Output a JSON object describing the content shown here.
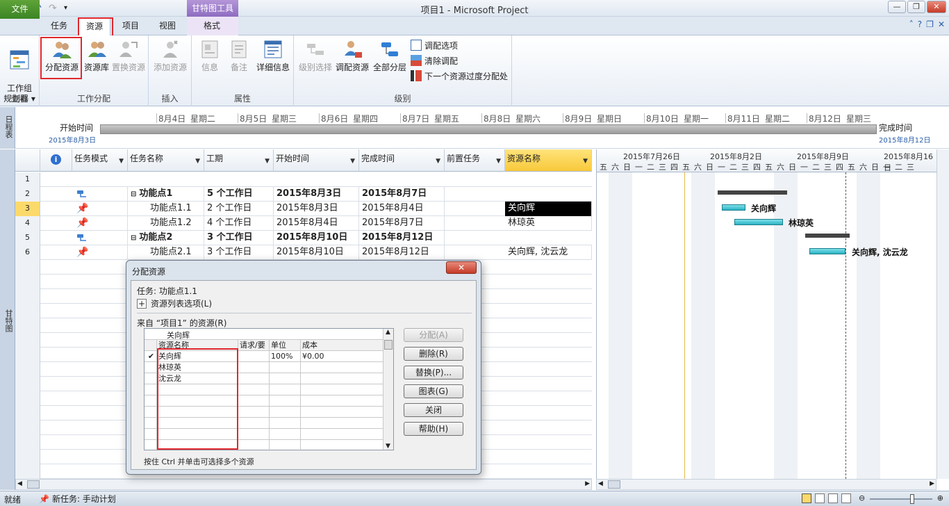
{
  "window": {
    "title": "项目1 - Microsoft Project",
    "context_group": "甘特图工具"
  },
  "tabs": [
    "文件",
    "任务",
    "资源",
    "项目",
    "视图",
    "格式"
  ],
  "ribbon": {
    "groups": {
      "view": {
        "label": "查看",
        "team_planner": "工作组\n规划器 ▾"
      },
      "assignments": {
        "label": "工作分配",
        "assign": "分配资源",
        "pool": "资源库",
        "replace": "置换资源"
      },
      "insert": {
        "label": "插入",
        "add": "添加资源"
      },
      "properties": {
        "label": "属性",
        "info": "信息",
        "notes": "备注",
        "details": "详细信息"
      },
      "level": {
        "label": "级别",
        "level_selection": "级别选择",
        "level_resource": "调配资源",
        "level_all": "全部分层",
        "options": "调配选项",
        "clear": "清除调配",
        "next": "下一个资源过度分配处"
      }
    }
  },
  "timeline": {
    "side_label": "日程表",
    "start_label": "开始时间",
    "start_date": "2015年8月3日",
    "end_label": "完成时间",
    "end_date": "2015年8月12日",
    "dates": [
      "8月4日",
      "星期二",
      "8月5日",
      "星期三",
      "8月6日",
      "星期四",
      "8月7日",
      "星期五",
      "8月8日",
      "星期六",
      "8月9日",
      "星期日",
      "8月10日",
      "星期一",
      "8月11日",
      "星期二",
      "8月12日",
      "星期三"
    ]
  },
  "gantt_side_label": "甘特图",
  "table": {
    "headers": [
      "任务模式",
      "任务名称",
      "工期",
      "开始时间",
      "完成时间",
      "前置任务",
      "资源名称"
    ],
    "rows": [
      {
        "id": "1",
        "name": "",
        "duration": "",
        "start": "",
        "finish": "",
        "resource": ""
      },
      {
        "id": "2",
        "name": "功能点1",
        "duration": "5 个工作日",
        "start": "2015年8月3日",
        "finish": "2015年8月7日",
        "resource": ""
      },
      {
        "id": "3",
        "name": "功能点1.1",
        "duration": "2 个工作日",
        "start": "2015年8月3日",
        "finish": "2015年8月4日",
        "resource": "关向辉"
      },
      {
        "id": "4",
        "name": "功能点1.2",
        "duration": "4 个工作日",
        "start": "2015年8月4日",
        "finish": "2015年8月7日",
        "resource": "林琼英"
      },
      {
        "id": "5",
        "name": "功能点2",
        "duration": "3 个工作日",
        "start": "2015年8月10日",
        "finish": "2015年8月12日",
        "resource": ""
      },
      {
        "id": "6",
        "name": "功能点2.1",
        "duration": "3 个工作日",
        "start": "2015年8月10日",
        "finish": "2015年8月12日",
        "resource": "关向辉, 沈云龙"
      }
    ]
  },
  "gantt": {
    "weeks": [
      "2015年7月26日",
      "2015年8月2日",
      "2015年8月9日",
      "2015年8月16日"
    ],
    "days": [
      "五",
      "六",
      "日",
      "一",
      "二",
      "三",
      "四",
      "五",
      "六",
      "日",
      "一",
      "二",
      "三",
      "四",
      "五",
      "六",
      "日",
      "一",
      "二",
      "三",
      "四",
      "五",
      "六",
      "日",
      "一",
      "二",
      "三"
    ],
    "labels": [
      "关向辉",
      "林琼英",
      "关向辉, 沈云龙"
    ]
  },
  "dialog": {
    "title": "分配资源",
    "close": "✕",
    "task_label": "任务: 功能点1.1",
    "options_label": "资源列表选项(L)",
    "from_label": "来自 “项目1” 的资源(R)",
    "edit_value": "关向辉",
    "grid_headers": [
      "资源名称",
      "请求/要",
      "单位",
      "成本"
    ],
    "grid_rows": [
      {
        "check": "✔",
        "name": "关向辉",
        "units": "100%",
        "cost": "¥0.00"
      },
      {
        "check": "",
        "name": "林琼英",
        "units": "",
        "cost": ""
      },
      {
        "check": "",
        "name": "沈云龙",
        "units": "",
        "cost": ""
      }
    ],
    "buttons": [
      "分配(A)",
      "删除(R)",
      "替换(P)...",
      "图表(G)",
      "关闭",
      "帮助(H)"
    ],
    "hint": "按住 Ctrl 并单击可选择多个资源"
  },
  "statusbar": {
    "ready": "就绪",
    "new_task": "新任务: 手动计划"
  },
  "colors": {
    "accent_red": "#e0282e",
    "file_tab": "#3b8524",
    "gantt_bar": "#2ab2c3",
    "context": "#8e6cc1"
  }
}
